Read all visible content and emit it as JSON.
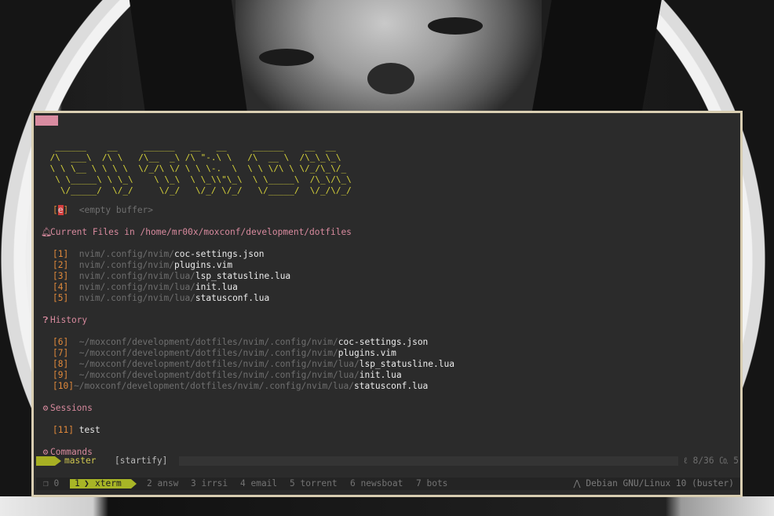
{
  "logo_lines": [
    "  ______    __     ______   __   __     ______    __  __",
    " /\\  ___\\  /\\ \\   /\\__  _\\ /\\ \"-.\\ \\   /\\  __ \\  /\\_\\_\\_\\",
    " \\ \\ \\__ \\ \\ \\ \\  \\/_/\\ \\/ \\ \\ \\-.  \\  \\ \\ \\/\\ \\ \\/_/\\_\\/_",
    "  \\ \\_____\\ \\ \\_\\    \\ \\_\\  \\ \\_\\\\\"\\_\\  \\ \\_____\\  /\\_\\/\\_\\",
    "   \\/_____/  \\/_/     \\/_/   \\/_/ \\/_/   \\/_____/  \\/_/\\/_/"
  ],
  "empty_buffer": {
    "key": "e",
    "label": "<empty buffer>"
  },
  "sections": {
    "current_files": {
      "title": "Current Files in /home/mr00x/moxconf/development/dotfiles",
      "icon": "bell-icon",
      "items": [
        {
          "num": "1",
          "path": "nvim/.config/nvim/",
          "file": "coc-settings.json"
        },
        {
          "num": "2",
          "path": "nvim/.config/nvim/",
          "file": "plugins.vim"
        },
        {
          "num": "3",
          "path": "nvim/.config/nvim/lua/",
          "file": "lsp_statusline.lua"
        },
        {
          "num": "4",
          "path": "nvim/.config/nvim/lua/",
          "file": "init.lua"
        },
        {
          "num": "5",
          "path": "nvim/.config/nvim/lua/",
          "file": "statusconf.lua"
        }
      ]
    },
    "history": {
      "title": "History",
      "icon": "question-circle-icon",
      "items": [
        {
          "num": "6",
          "path": "~/moxconf/development/dotfiles/nvim/.config/nvim/",
          "file": "coc-settings.json"
        },
        {
          "num": "7",
          "path": "~/moxconf/development/dotfiles/nvim/.config/nvim/",
          "file": "plugins.vim"
        },
        {
          "num": "8",
          "path": "~/moxconf/development/dotfiles/nvim/.config/nvim/lua/",
          "file": "lsp_statusline.lua"
        },
        {
          "num": "9",
          "path": "~/moxconf/development/dotfiles/nvim/.config/nvim/lua/",
          "file": "init.lua"
        },
        {
          "num": "10",
          "path": "~/moxconf/development/dotfiles/nvim/.config/nvim/lua/",
          "file": "statusconf.lua"
        }
      ]
    },
    "sessions": {
      "title": "Sessions",
      "icon": "gear-icon",
      "items": [
        {
          "num": "11",
          "name": "test"
        }
      ]
    },
    "commands": {
      "title": "Commands",
      "icon": "gears-icon"
    }
  },
  "statusline": {
    "branch": "master",
    "filetype": "[startify]",
    "right": "ℓ 8/36 ㏇ 5"
  },
  "tmux": {
    "pane": "❐ 0",
    "active_window": {
      "num": "1",
      "name": "xterm"
    },
    "windows": [
      "2 answ",
      "3 irrsi",
      "4 email",
      "5 torrent",
      "6 newsboat",
      "7 bots"
    ],
    "os": "Debian GNU/Linux 10 (buster)",
    "os_icon": "arch-icon"
  },
  "colors": {
    "frame": "#d9ceb2",
    "background": "#2b2b2b",
    "logo": "#d7d33a",
    "number": "#e0893b",
    "header": "#d88a9e",
    "accent_green": "#a8b526"
  }
}
